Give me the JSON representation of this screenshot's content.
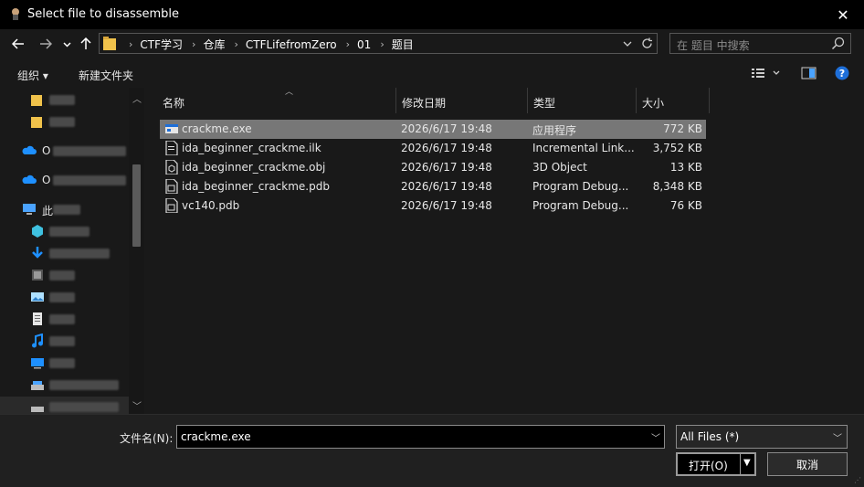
{
  "window": {
    "title": "Select file to disassemble"
  },
  "address_bar": {
    "crumbs": [
      "CTF学习",
      "仓库",
      "CTFLifefromZero",
      "01",
      "题目"
    ]
  },
  "search": {
    "placeholder": "在 题目 中搜索"
  },
  "toolbar": {
    "organize_label": "组织 ▾",
    "new_folder_label": "新建文件夹"
  },
  "sidebar": {
    "items": [
      {
        "icon": "folder-icon",
        "label": ""
      },
      {
        "icon": "folder-icon",
        "label": ""
      },
      {
        "icon": "cloud-icon",
        "label": "O"
      },
      {
        "icon": "cloud-icon",
        "label": "O"
      },
      {
        "icon": "pc-icon",
        "label": "此"
      },
      {
        "icon": "3d-objects-icon",
        "label": ""
      },
      {
        "icon": "downloads-icon",
        "label": ""
      },
      {
        "icon": "videos-icon",
        "label": ""
      },
      {
        "icon": "pictures-icon",
        "label": ""
      },
      {
        "icon": "documents-icon",
        "label": ""
      },
      {
        "icon": "music-icon",
        "label": ""
      },
      {
        "icon": "desktop-icon",
        "label": ""
      },
      {
        "icon": "drive-icon",
        "label": ""
      },
      {
        "icon": "drive-icon",
        "label": ""
      }
    ]
  },
  "columns": {
    "name": "名称",
    "date": "修改日期",
    "type": "类型",
    "size": "大小"
  },
  "files": [
    {
      "name": "crackme.exe",
      "date": "2026/6/17 19:48",
      "type": "应用程序",
      "size": "772 KB",
      "icon": "exe-icon",
      "selected": true
    },
    {
      "name": "ida_beginner_crackme.ilk",
      "date": "2026/6/17 19:48",
      "type": "Incremental Link...",
      "size": "3,752 KB",
      "icon": "file-icon",
      "selected": false
    },
    {
      "name": "ida_beginner_crackme.obj",
      "date": "2026/6/17 19:48",
      "type": "3D Object",
      "size": "13 KB",
      "icon": "3d-file-icon",
      "selected": false
    },
    {
      "name": "ida_beginner_crackme.pdb",
      "date": "2026/6/17 19:48",
      "type": "Program Debug...",
      "size": "8,348 KB",
      "icon": "pdb-file-icon",
      "selected": false
    },
    {
      "name": "vc140.pdb",
      "date": "2026/6/17 19:48",
      "type": "Program Debug...",
      "size": "76 KB",
      "icon": "pdb-file-icon",
      "selected": false
    }
  ],
  "bottom": {
    "filename_label": "文件名(N):",
    "filename_value": "crackme.exe",
    "filter_value": "All Files (*)",
    "open_label": "打开(O)",
    "cancel_label": "取消"
  },
  "colors": {
    "background": "#191919",
    "titlebar": "#000000",
    "selected_row": "#777777",
    "accent_blue": "#1e90ff"
  }
}
